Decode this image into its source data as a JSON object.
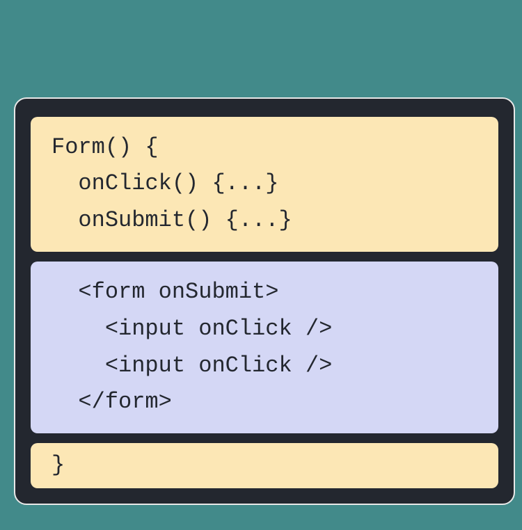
{
  "top": {
    "line1": "Form() {",
    "line2": "  onClick() {...}",
    "line3": "  onSubmit() {...}"
  },
  "middle": {
    "line1": "  <form onSubmit>",
    "line2": "    <input onClick />",
    "line3": "    <input onClick />",
    "line4": "  </form>"
  },
  "bottom": {
    "line1": "}"
  }
}
